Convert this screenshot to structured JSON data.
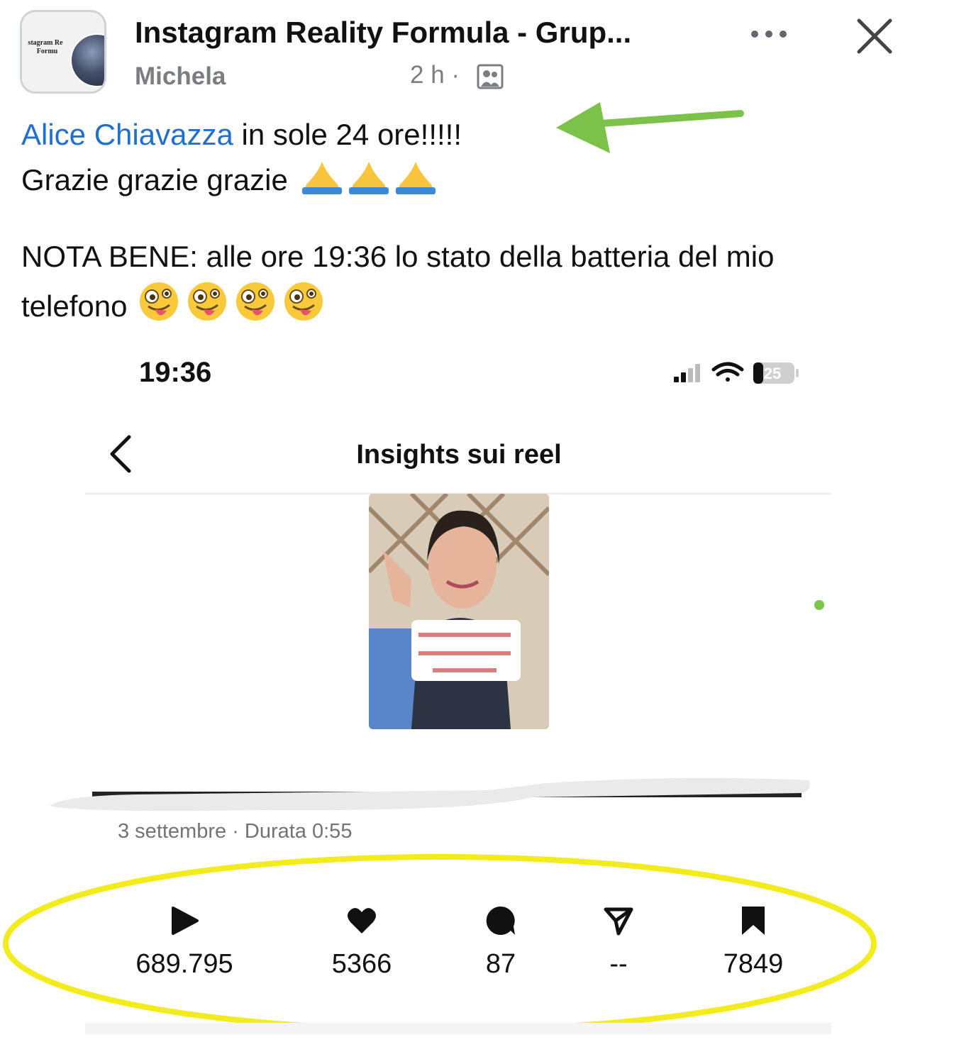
{
  "post": {
    "group_name": "Instagram Reality Formula - Grup...",
    "author": "Michela",
    "time": "2 h ·",
    "avatar_logo_text": "Instagram Reality Formula",
    "mention": "Alice Chiavazza",
    "line1_rest": " in sole 24 ore!!!!!",
    "line2": "Grazie grazie grazie ",
    "line3": "NOTA BENE: alle ore 19:36 lo stato della batteria del mio",
    "line4": "telefono ",
    "icons": [
      "group-icon",
      "more-icon",
      "close-icon",
      "folded-hands-emoji",
      "zany-face-emoji",
      "green-arrow-annotation"
    ],
    "accent_color": "#1f6fd1"
  },
  "phone": {
    "time": "19:36",
    "battery": "25",
    "title": "Insights sui reel",
    "reel_meta": "3 settembre · Durata 0:55",
    "metrics": [
      {
        "icon": "play-icon",
        "value": "689.795"
      },
      {
        "icon": "heart-icon",
        "value": "5366"
      },
      {
        "icon": "comment-icon",
        "value": "87"
      },
      {
        "icon": "share-icon",
        "value": "--"
      },
      {
        "icon": "bookmark-icon",
        "value": "7849"
      }
    ],
    "highlight_color": "#f2ec1c",
    "arrow_color": "#7cc24a"
  }
}
